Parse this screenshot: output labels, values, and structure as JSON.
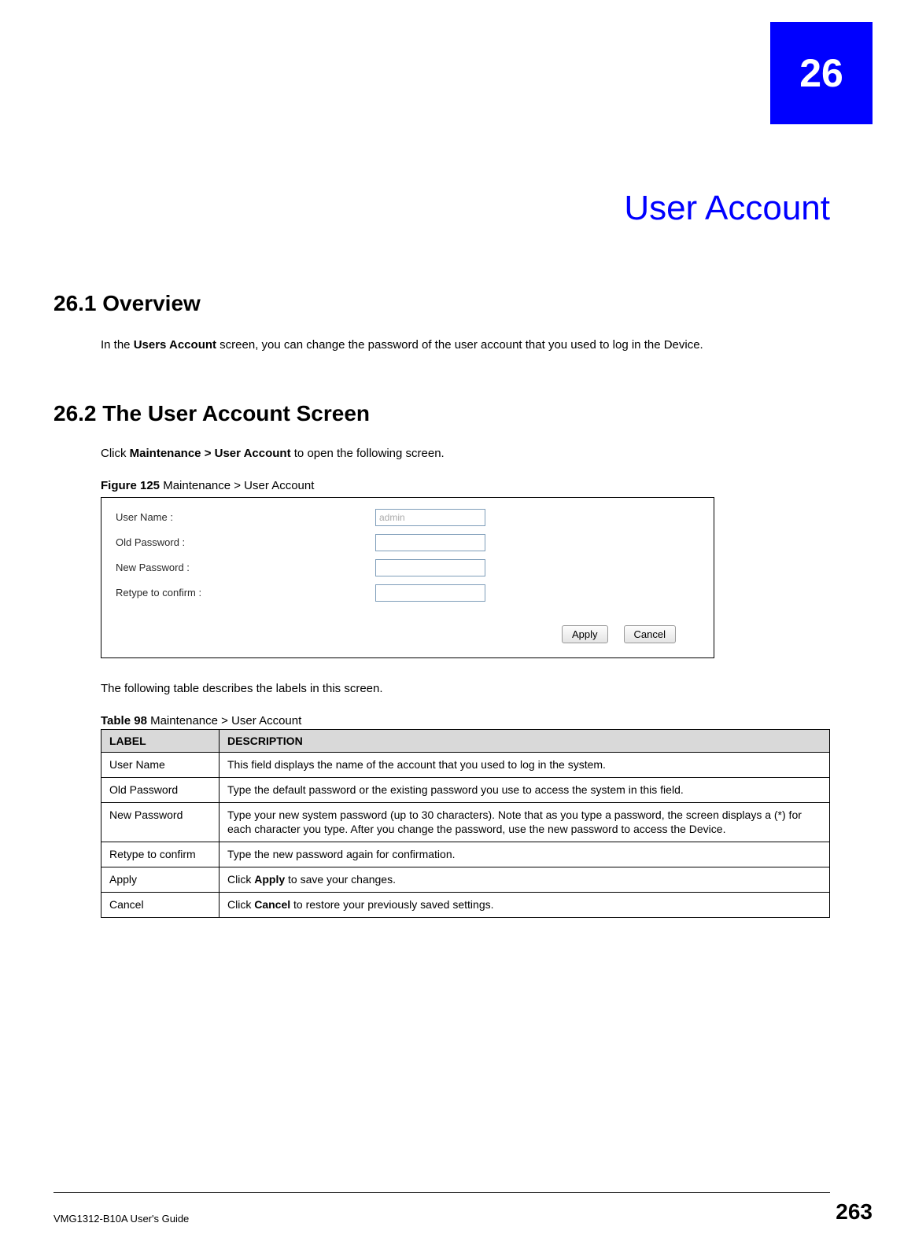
{
  "chapter_number": "26",
  "page_title": "User Account",
  "section1": {
    "heading": "26.1  Overview",
    "body_prefix": "In the ",
    "body_bold": "Users Account",
    "body_suffix": " screen, you can change the password of the user account that you used to log in the Device."
  },
  "section2": {
    "heading": "26.2  The User Account Screen",
    "instr_prefix": "Click ",
    "instr_bold": "Maintenance > User Account",
    "instr_suffix": " to open the following screen.",
    "figure_label": "Figure 125",
    "figure_title": "   Maintenance > User Account",
    "form": {
      "username_label": "User Name :",
      "username_value": "admin",
      "oldpw_label": "Old Password :",
      "newpw_label": "New Password :",
      "retype_label": "Retype to confirm :",
      "apply_btn": "Apply",
      "cancel_btn": "Cancel"
    },
    "after_figure": "The following table describes the labels in this screen.",
    "table_label": "Table 98",
    "table_title": "   Maintenance > User Account",
    "headers": {
      "label": "LABEL",
      "description": "DESCRIPTION"
    },
    "rows": [
      {
        "label": "User Name",
        "desc_plain": "This field displays the name of the account that you used to log in the system."
      },
      {
        "label": "Old Password",
        "desc_plain": "Type the default password or the existing password you use to access the system in this field."
      },
      {
        "label": "New Password",
        "desc_plain": "Type your new system password (up to 30 characters). Note that as you type a password, the screen displays a (*) for each character you type. After you change the password, use the new password to access the Device."
      },
      {
        "label": "Retype to confirm",
        "desc_plain": "Type the new password again for confirmation."
      },
      {
        "label": "Apply",
        "desc_pre": "Click ",
        "desc_bold": "Apply",
        "desc_post": " to save your changes."
      },
      {
        "label": "Cancel",
        "desc_pre": "Click ",
        "desc_bold": "Cancel",
        "desc_post": " to restore your previously saved settings."
      }
    ]
  },
  "footer": {
    "guide": "VMG1312-B10A User's Guide",
    "page": "263"
  }
}
